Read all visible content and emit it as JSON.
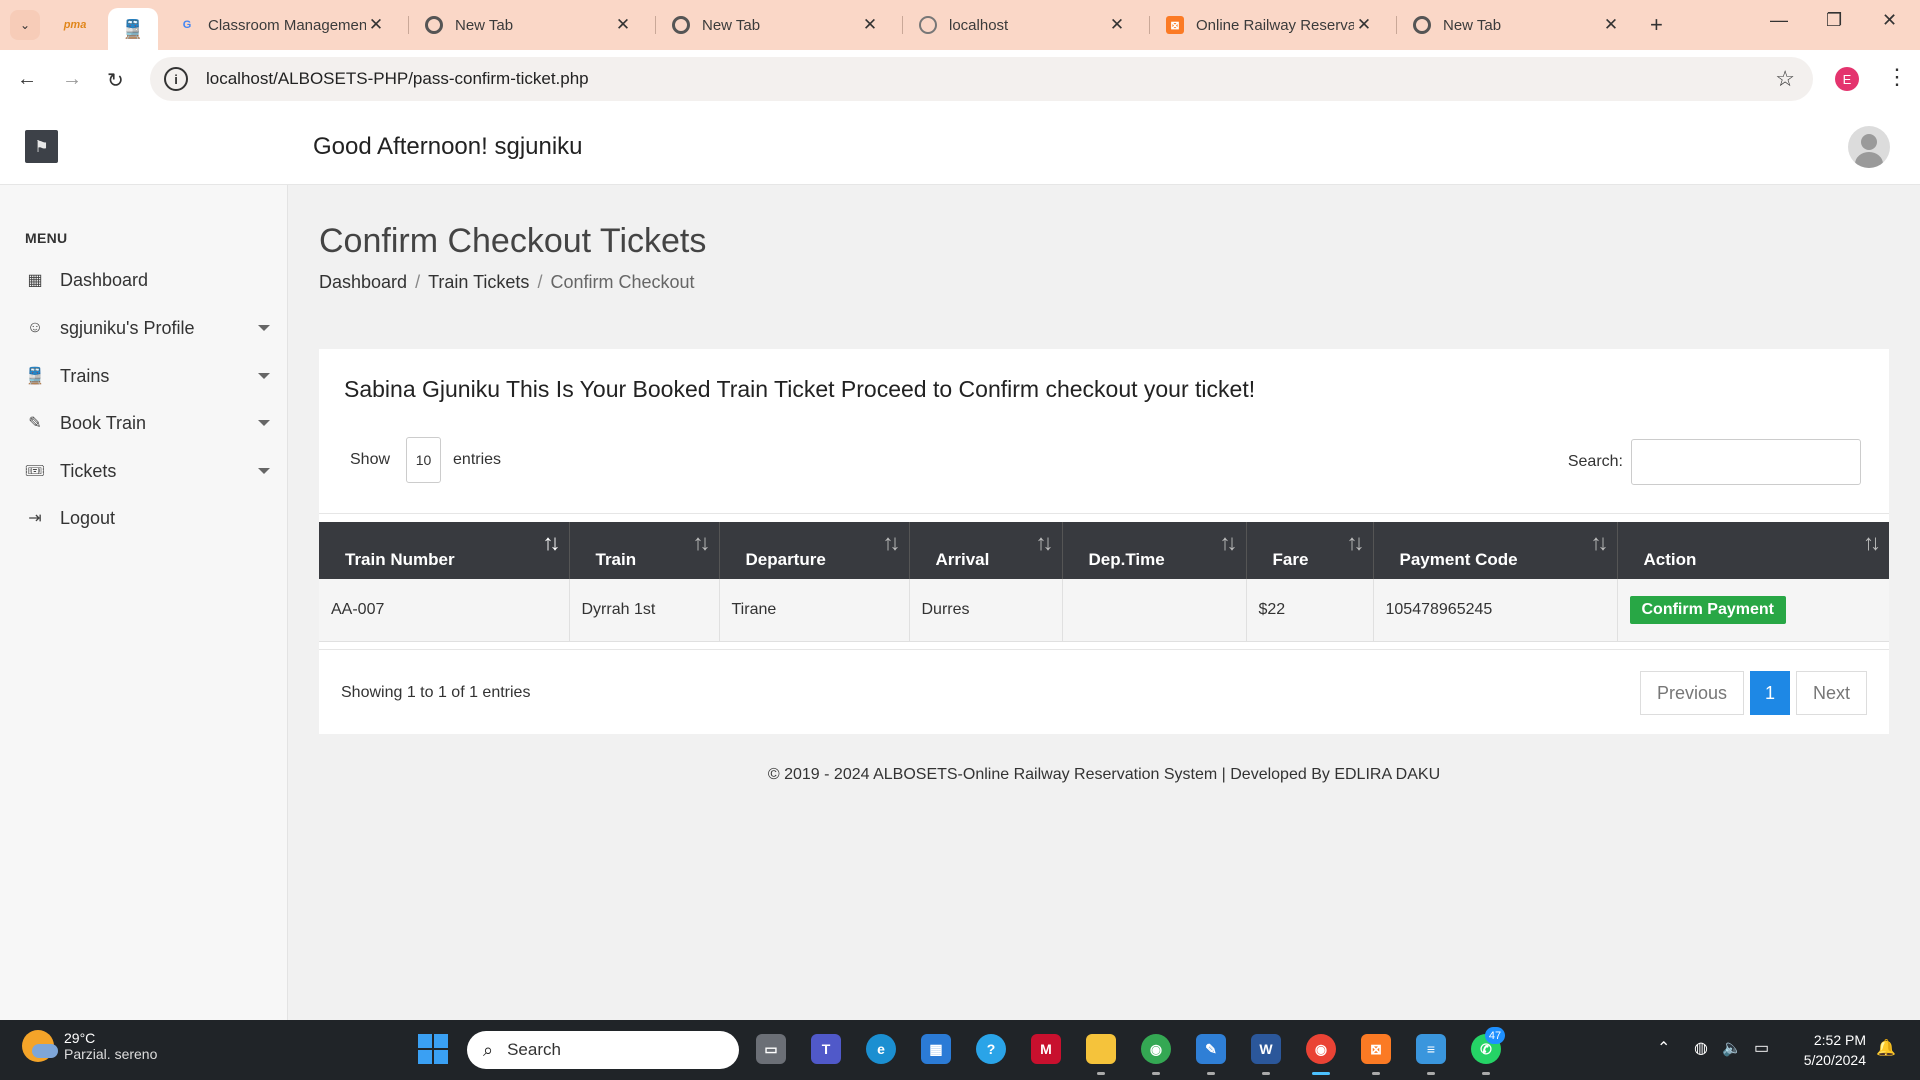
{
  "browser": {
    "tabs": [
      {
        "title": "Classroom Managemen",
        "favicon": "google-icon"
      },
      {
        "title": "New Tab",
        "favicon": "chrome-icon"
      },
      {
        "title": "New Tab",
        "favicon": "chrome-icon"
      },
      {
        "title": "localhost",
        "favicon": "globe-icon"
      },
      {
        "title": "Online Railway Reservat",
        "favicon": "xampp-icon"
      },
      {
        "title": "New Tab",
        "favicon": "chrome-icon"
      }
    ],
    "url": "localhost/ALBOSETS-PHP/pass-confirm-ticket.php",
    "profile_initial": "E"
  },
  "header": {
    "greeting": "Good Afternoon! sgjuniku"
  },
  "sidebar": {
    "menu_title": "MENU",
    "items": [
      {
        "label": "Dashboard",
        "icon": "dashboard-icon",
        "has_submenu": false
      },
      {
        "label": "sgjuniku's Profile",
        "icon": "smile-icon",
        "has_submenu": true
      },
      {
        "label": "Trains",
        "icon": "train-icon",
        "has_submenu": true
      },
      {
        "label": "Book Train",
        "icon": "edit-icon",
        "has_submenu": true
      },
      {
        "label": "Tickets",
        "icon": "ticket-icon",
        "has_submenu": true
      },
      {
        "label": "Logout",
        "icon": "logout-icon",
        "has_submenu": false
      }
    ]
  },
  "main": {
    "page_title": "Confirm Checkout Tickets",
    "breadcrumb": [
      "Dashboard",
      "Train Tickets",
      "Confirm Checkout"
    ],
    "card_heading": "Sabina Gjuniku This Is Your Booked Train Ticket Proceed to Confirm checkout your ticket!",
    "show_label": "Show",
    "entries_value": "10",
    "entries_label": "entries",
    "search_label": "Search:",
    "search_value": "",
    "table": {
      "columns": [
        "Train Number",
        "Train",
        "Departure",
        "Arrival",
        "Dep.Time",
        "Fare",
        "Payment Code",
        "Action"
      ],
      "rows": [
        {
          "train_number": "AA-007",
          "train": "Dyrrah 1st",
          "departure": "Tirane",
          "arrival": "Durres",
          "dep_time": "",
          "fare": "$22",
          "payment_code": "105478965245",
          "action": "Confirm Payment"
        }
      ]
    },
    "info": "Showing 1 to 1 of 1 entries",
    "pager": {
      "previous": "Previous",
      "current": "1",
      "next": "Next"
    },
    "footer": "© 2019 - 2024 ALBOSETS-Online Railway Reservation System | Developed By EDLIRA DAKU"
  },
  "taskbar": {
    "weather_temp": "29°C",
    "weather_desc": "Parzial. sereno",
    "search_placeholder": "Search",
    "whatsapp_badge": "47",
    "time": "2:52 PM",
    "date": "5/20/2024"
  },
  "colors": {
    "tabbar": "#fad7c7",
    "table_header": "#383a3f",
    "confirm_button": "#28a745",
    "pager_active": "#1e88e5",
    "taskbar": "#202428"
  }
}
